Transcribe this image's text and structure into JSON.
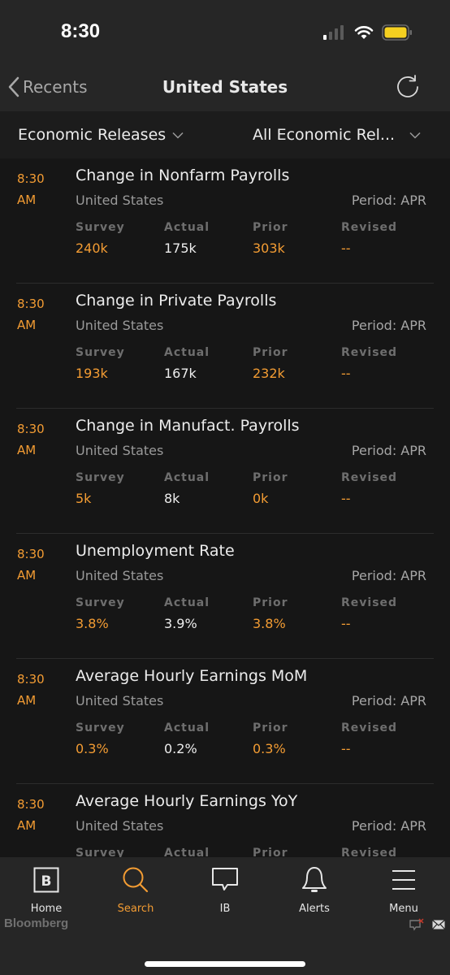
{
  "status_bar": {
    "time": "8:30",
    "signal_icon": "cellular-signal-icon",
    "wifi_icon": "wifi-icon",
    "battery_icon": "battery-icon",
    "battery_color": "#f5d020"
  },
  "nav": {
    "back_label": "Recents",
    "title": "United States",
    "refresh_icon": "refresh-icon"
  },
  "filters": {
    "category": "Economic Releases",
    "type": "All Economic Rel..."
  },
  "columns": [
    "Survey",
    "Actual",
    "Prior",
    "Revised"
  ],
  "releases": [
    {
      "time": "8:30",
      "ampm": "AM",
      "title": "Change in Nonfarm Payrolls",
      "country": "United States",
      "period": "Period: APR",
      "survey": "240k",
      "actual": "175k",
      "prior": "303k",
      "revised": "--"
    },
    {
      "time": "8:30",
      "ampm": "AM",
      "title": "Change in Private Payrolls",
      "country": "United States",
      "period": "Period: APR",
      "survey": "193k",
      "actual": "167k",
      "prior": "232k",
      "revised": "--"
    },
    {
      "time": "8:30",
      "ampm": "AM",
      "title": "Change in Manufact. Payrolls",
      "country": "United States",
      "period": "Period: APR",
      "survey": "5k",
      "actual": "8k",
      "prior": "0k",
      "revised": "--"
    },
    {
      "time": "8:30",
      "ampm": "AM",
      "title": "Unemployment Rate",
      "country": "United States",
      "period": "Period: APR",
      "survey": "3.8%",
      "actual": "3.9%",
      "prior": "3.8%",
      "revised": "--"
    },
    {
      "time": "8:30",
      "ampm": "AM",
      "title": "Average Hourly Earnings MoM",
      "country": "United States",
      "period": "Period: APR",
      "survey": "0.3%",
      "actual": "0.2%",
      "prior": "0.3%",
      "revised": "--"
    },
    {
      "time": "8:30",
      "ampm": "AM",
      "title": "Average Hourly Earnings YoY",
      "country": "United States",
      "period": "Period: APR",
      "survey": "",
      "actual": "",
      "prior": "",
      "revised": ""
    }
  ],
  "tabs": [
    {
      "label": "Home",
      "icon": "bloomberg-b-icon",
      "active": false
    },
    {
      "label": "Search",
      "icon": "search-icon",
      "active": true
    },
    {
      "label": "IB",
      "icon": "chat-bubble-icon",
      "active": false
    },
    {
      "label": "Alerts",
      "icon": "bell-icon",
      "active": false
    },
    {
      "label": "Menu",
      "icon": "hamburger-menu-icon",
      "active": false
    }
  ],
  "footer": {
    "brand": "Bloomberg",
    "icons": [
      "chat-closed-icon",
      "mail-icon"
    ]
  },
  "colors": {
    "accent": "#f39c33",
    "list_bg": "#161616",
    "chrome_bg": "#262626",
    "filter_bg": "#1c1c1c"
  }
}
